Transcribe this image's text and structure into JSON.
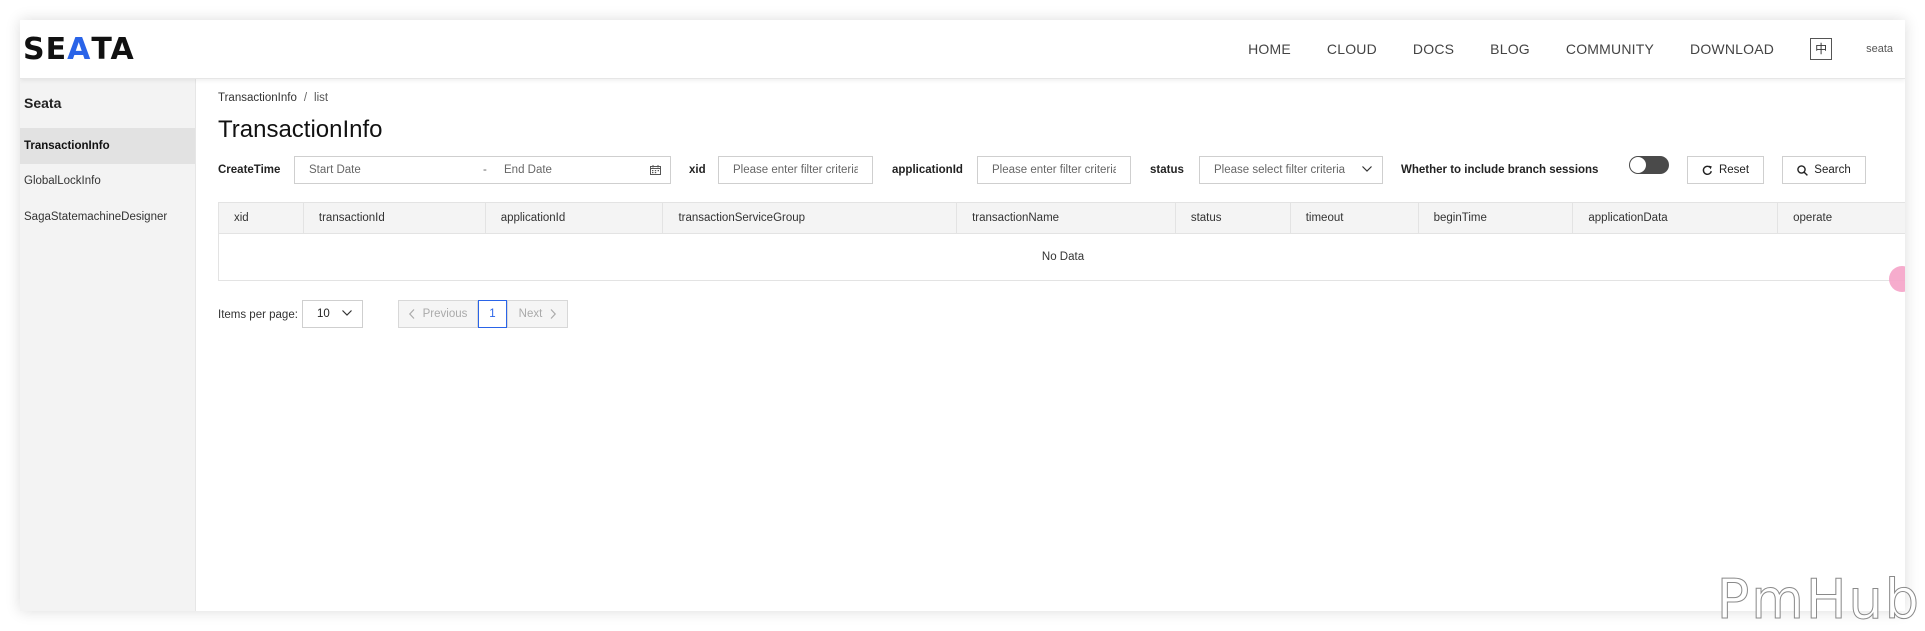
{
  "header": {
    "logo": {
      "prefix": "SE",
      "highlight": "A",
      "suffix": "TA"
    },
    "nav": [
      "HOME",
      "CLOUD",
      "DOCS",
      "BLOG",
      "COMMUNITY",
      "DOWNLOAD"
    ],
    "lang": "中",
    "user": "seata"
  },
  "sidebar": {
    "title": "Seata",
    "items": [
      {
        "label": "TransactionInfo"
      },
      {
        "label": "GlobalLockInfo"
      },
      {
        "label": "SagaStatemachineDesigner"
      }
    ],
    "active": "TransactionInfo"
  },
  "breadcrumb": {
    "root": "TransactionInfo",
    "separator": "/",
    "current": "list"
  },
  "page_title": "TransactionInfo",
  "filters": {
    "create_time_label": "CreateTime",
    "start_placeholder": "Start Date",
    "date_separator": "-",
    "end_placeholder": "End Date",
    "xid_label": "xid",
    "xid_placeholder": "Please enter filter criteria",
    "app_label": "applicationId",
    "app_placeholder": "Please enter filter criteria",
    "status_label": "status",
    "status_placeholder": "Please select filter criteria",
    "branch_label": "Whether to include branch sessions",
    "branch_enabled": false,
    "reset_label": "Reset",
    "search_label": "Search"
  },
  "table": {
    "columns": [
      "xid",
      "transactionId",
      "applicationId",
      "transactionServiceGroup",
      "transactionName",
      "status",
      "timeout",
      "beginTime",
      "applicationData",
      "operate"
    ],
    "empty_text": "No Data"
  },
  "pagination": {
    "items_label": "Items per page:",
    "page_size": "10",
    "prev_label": "Previous",
    "current_page": "1",
    "next_label": "Next"
  },
  "watermark": "PmHub",
  "colors": {
    "accent": "#2a64e8",
    "toggle_off": "#4a4a4a",
    "sidebar_bg": "#f3f3f3"
  }
}
